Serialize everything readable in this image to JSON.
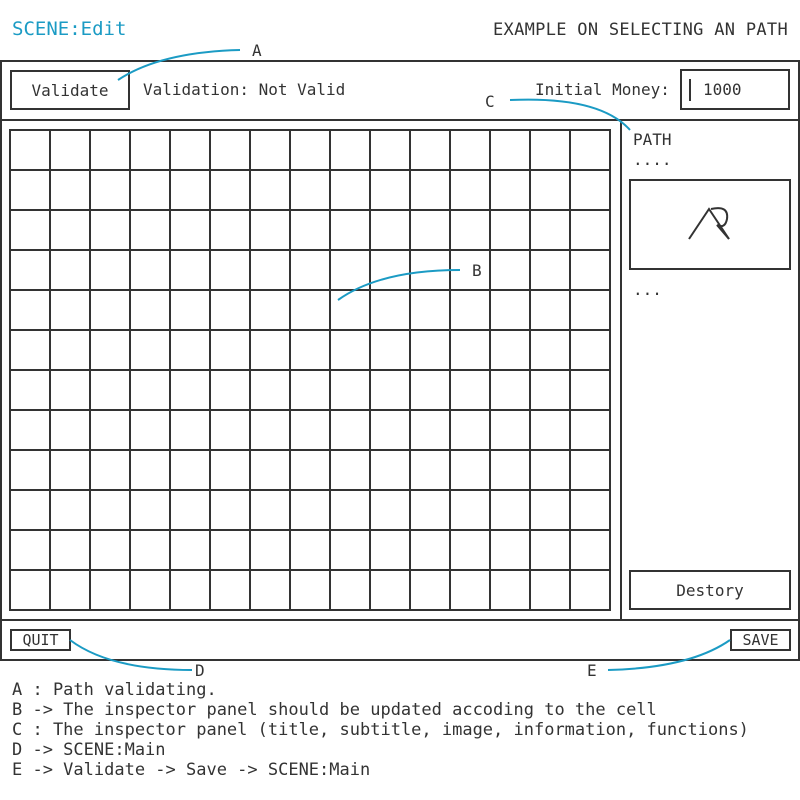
{
  "header": {
    "scene_title": "SCENE:Edit",
    "example_title": "EXAMPLE ON SELECTING AN PATH"
  },
  "toolbar": {
    "validate_label": "Validate",
    "validation_status": "Validation: Not Valid",
    "initial_money_label": "Initial Money:",
    "initial_money_value": "1000"
  },
  "grid": {
    "rows": 12,
    "cols": 15
  },
  "inspector": {
    "title": "PATH",
    "subtitle": "....",
    "image_icon": "mountain-path-icon",
    "information": "...",
    "destroy_label": "Destory"
  },
  "footer": {
    "quit_label": "QUIT",
    "save_label": "SAVE"
  },
  "callouts": {
    "a": "A",
    "b": "B",
    "c": "C",
    "d": "D",
    "e": "E"
  },
  "notes": [
    "A : Path validating.",
    "B -> The inspector panel should be updated accoding to the cell",
    "C : The inspector panel (title, subtitle, image, information, functions)",
    "D -> SCENE:Main",
    "E -> Validate -> Save -> SCENE:Main"
  ],
  "colors": {
    "accent": "#1b9bc4",
    "ink": "#333333"
  }
}
